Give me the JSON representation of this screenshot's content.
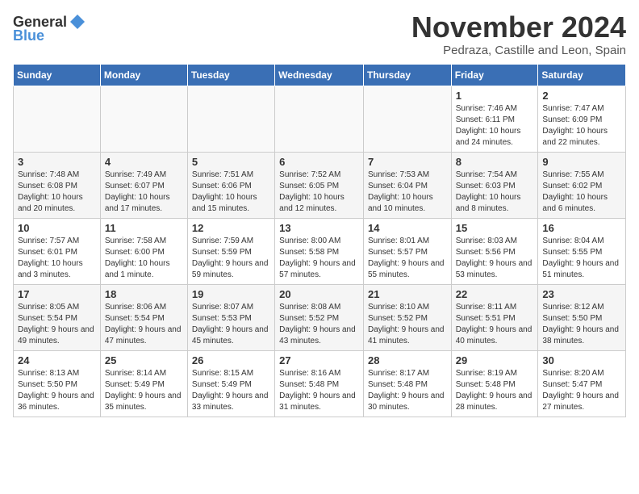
{
  "header": {
    "logo_general": "General",
    "logo_blue": "Blue",
    "month": "November 2024",
    "location": "Pedraza, Castille and Leon, Spain"
  },
  "weekdays": [
    "Sunday",
    "Monday",
    "Tuesday",
    "Wednesday",
    "Thursday",
    "Friday",
    "Saturday"
  ],
  "weeks": [
    [
      {
        "day": "",
        "info": ""
      },
      {
        "day": "",
        "info": ""
      },
      {
        "day": "",
        "info": ""
      },
      {
        "day": "",
        "info": ""
      },
      {
        "day": "",
        "info": ""
      },
      {
        "day": "1",
        "info": "Sunrise: 7:46 AM\nSunset: 6:11 PM\nDaylight: 10 hours and 24 minutes."
      },
      {
        "day": "2",
        "info": "Sunrise: 7:47 AM\nSunset: 6:09 PM\nDaylight: 10 hours and 22 minutes."
      }
    ],
    [
      {
        "day": "3",
        "info": "Sunrise: 7:48 AM\nSunset: 6:08 PM\nDaylight: 10 hours and 20 minutes."
      },
      {
        "day": "4",
        "info": "Sunrise: 7:49 AM\nSunset: 6:07 PM\nDaylight: 10 hours and 17 minutes."
      },
      {
        "day": "5",
        "info": "Sunrise: 7:51 AM\nSunset: 6:06 PM\nDaylight: 10 hours and 15 minutes."
      },
      {
        "day": "6",
        "info": "Sunrise: 7:52 AM\nSunset: 6:05 PM\nDaylight: 10 hours and 12 minutes."
      },
      {
        "day": "7",
        "info": "Sunrise: 7:53 AM\nSunset: 6:04 PM\nDaylight: 10 hours and 10 minutes."
      },
      {
        "day": "8",
        "info": "Sunrise: 7:54 AM\nSunset: 6:03 PM\nDaylight: 10 hours and 8 minutes."
      },
      {
        "day": "9",
        "info": "Sunrise: 7:55 AM\nSunset: 6:02 PM\nDaylight: 10 hours and 6 minutes."
      }
    ],
    [
      {
        "day": "10",
        "info": "Sunrise: 7:57 AM\nSunset: 6:01 PM\nDaylight: 10 hours and 3 minutes."
      },
      {
        "day": "11",
        "info": "Sunrise: 7:58 AM\nSunset: 6:00 PM\nDaylight: 10 hours and 1 minute."
      },
      {
        "day": "12",
        "info": "Sunrise: 7:59 AM\nSunset: 5:59 PM\nDaylight: 9 hours and 59 minutes."
      },
      {
        "day": "13",
        "info": "Sunrise: 8:00 AM\nSunset: 5:58 PM\nDaylight: 9 hours and 57 minutes."
      },
      {
        "day": "14",
        "info": "Sunrise: 8:01 AM\nSunset: 5:57 PM\nDaylight: 9 hours and 55 minutes."
      },
      {
        "day": "15",
        "info": "Sunrise: 8:03 AM\nSunset: 5:56 PM\nDaylight: 9 hours and 53 minutes."
      },
      {
        "day": "16",
        "info": "Sunrise: 8:04 AM\nSunset: 5:55 PM\nDaylight: 9 hours and 51 minutes."
      }
    ],
    [
      {
        "day": "17",
        "info": "Sunrise: 8:05 AM\nSunset: 5:54 PM\nDaylight: 9 hours and 49 minutes."
      },
      {
        "day": "18",
        "info": "Sunrise: 8:06 AM\nSunset: 5:54 PM\nDaylight: 9 hours and 47 minutes."
      },
      {
        "day": "19",
        "info": "Sunrise: 8:07 AM\nSunset: 5:53 PM\nDaylight: 9 hours and 45 minutes."
      },
      {
        "day": "20",
        "info": "Sunrise: 8:08 AM\nSunset: 5:52 PM\nDaylight: 9 hours and 43 minutes."
      },
      {
        "day": "21",
        "info": "Sunrise: 8:10 AM\nSunset: 5:52 PM\nDaylight: 9 hours and 41 minutes."
      },
      {
        "day": "22",
        "info": "Sunrise: 8:11 AM\nSunset: 5:51 PM\nDaylight: 9 hours and 40 minutes."
      },
      {
        "day": "23",
        "info": "Sunrise: 8:12 AM\nSunset: 5:50 PM\nDaylight: 9 hours and 38 minutes."
      }
    ],
    [
      {
        "day": "24",
        "info": "Sunrise: 8:13 AM\nSunset: 5:50 PM\nDaylight: 9 hours and 36 minutes."
      },
      {
        "day": "25",
        "info": "Sunrise: 8:14 AM\nSunset: 5:49 PM\nDaylight: 9 hours and 35 minutes."
      },
      {
        "day": "26",
        "info": "Sunrise: 8:15 AM\nSunset: 5:49 PM\nDaylight: 9 hours and 33 minutes."
      },
      {
        "day": "27",
        "info": "Sunrise: 8:16 AM\nSunset: 5:48 PM\nDaylight: 9 hours and 31 minutes."
      },
      {
        "day": "28",
        "info": "Sunrise: 8:17 AM\nSunset: 5:48 PM\nDaylight: 9 hours and 30 minutes."
      },
      {
        "day": "29",
        "info": "Sunrise: 8:19 AM\nSunset: 5:48 PM\nDaylight: 9 hours and 28 minutes."
      },
      {
        "day": "30",
        "info": "Sunrise: 8:20 AM\nSunset: 5:47 PM\nDaylight: 9 hours and 27 minutes."
      }
    ]
  ]
}
